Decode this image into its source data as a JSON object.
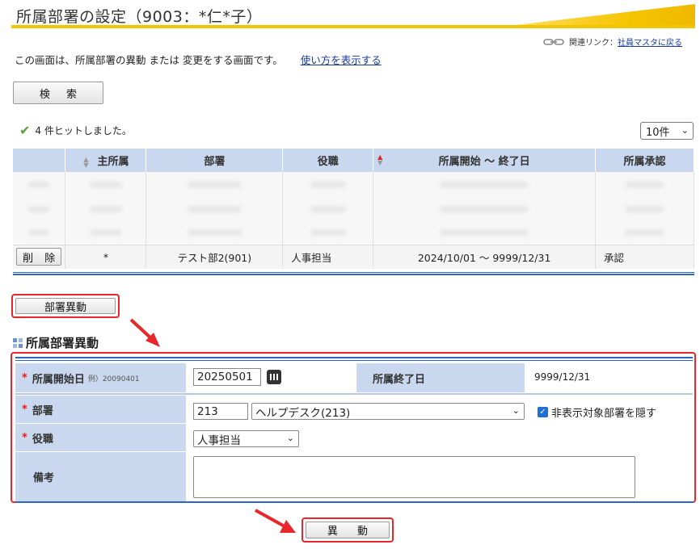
{
  "header": {
    "title": "所属部署の設定（9003：*仁*子）",
    "related_label": "関連リンク：",
    "related_link": "社員マスタに戻る"
  },
  "intro": {
    "text": "この画面は、所属部署の異動 または 変更をする画面です。",
    "help_link": "使い方を表示する"
  },
  "search": {
    "label": "検 索"
  },
  "results": {
    "hit_text": "4 件ヒットしました。",
    "page_size": "10件",
    "columns": [
      "",
      "主所属",
      "部署",
      "役職",
      "所属開始 ～ 終了日",
      "所属承認"
    ],
    "row": {
      "delete_label": "削 除",
      "primary": "*",
      "department": "テスト部2(901)",
      "position": "人事担当",
      "period": "2024/10/01 ～ 9999/12/31",
      "approval": "承認"
    }
  },
  "move_button": {
    "label": "部署異動"
  },
  "section": {
    "title": "所属部署異動"
  },
  "form": {
    "start_label": "所属開始日",
    "start_example": "例）20090401",
    "start_value": "20250501",
    "end_label": "所属終了日",
    "end_value": "9999/12/31",
    "dept_label": "部署",
    "dept_code": "213",
    "dept_select": "ヘルプデスク(213)",
    "hide_label": "非表示対象部署を隠す",
    "position_label": "役職",
    "position_value": "人事担当",
    "memo_label": "備考",
    "memo_value": ""
  },
  "submit": {
    "label": "異 動"
  },
  "colors": {
    "accent_blue": "#2b66c2",
    "label_bg": "#c9d8ee",
    "highlight_red": "#e8262b",
    "title_yellow": "#f5c400"
  }
}
